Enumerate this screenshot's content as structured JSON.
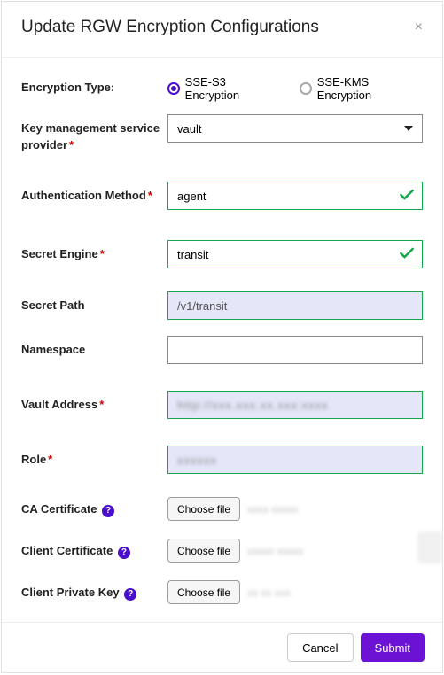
{
  "dialog": {
    "title": "Update RGW Encryption Configurations"
  },
  "labels": {
    "encryption_type": "Encryption Type:",
    "kms_provider": "Key management service provider",
    "auth_method": "Authentication Method",
    "secret_engine": "Secret Engine",
    "secret_path": "Secret Path",
    "namespace": "Namespace",
    "vault_address": "Vault Address",
    "role": "Role",
    "ca_cert": "CA Certificate",
    "client_cert": "Client Certificate",
    "client_key": "Client Private Key"
  },
  "radios": {
    "sse_s3": "SSE-S3 Encryption",
    "sse_kms": "SSE-KMS Encryption",
    "selected": "sse_s3"
  },
  "values": {
    "provider": "vault",
    "auth_method": "agent",
    "secret_engine": "transit",
    "secret_path": "/v1/transit",
    "namespace": "",
    "vault_address": "redacted",
    "role": "redacted"
  },
  "file": {
    "choose": "Choose file",
    "ca_name": "redacted",
    "client_name": "redacted",
    "key_name": "redacted"
  },
  "buttons": {
    "cancel": "Cancel",
    "submit": "Submit"
  }
}
